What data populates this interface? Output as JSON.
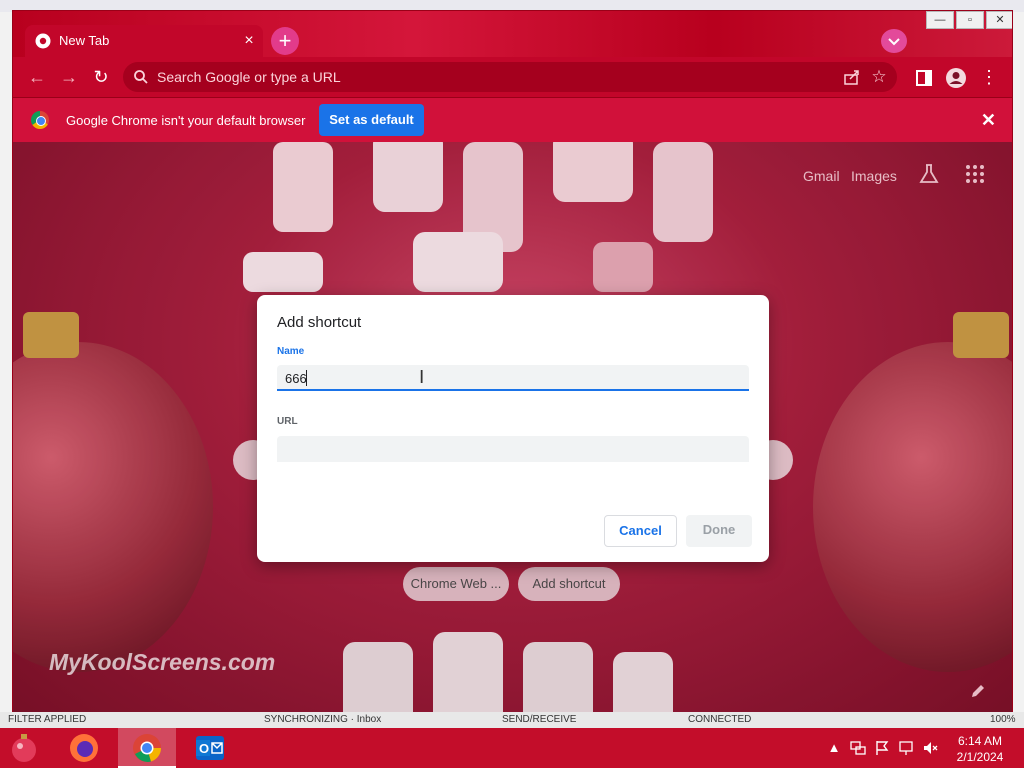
{
  "window": {
    "tab_title": "New Tab",
    "tab_close": "×",
    "new_tab": "+",
    "minimize": "—",
    "maximize": "▫",
    "close": "✕"
  },
  "toolbar": {
    "back": "←",
    "forward": "→",
    "reload": "↻",
    "omnibox_placeholder": "Search Google or type a URL",
    "bookmark_star": "☆",
    "menu": "⋮"
  },
  "infobar": {
    "message": "Google Chrome isn't your default browser",
    "set_default_label": "Set as default",
    "close": "✕"
  },
  "ntp": {
    "gmail": "Gmail",
    "images": "Images",
    "shortcuts": [
      "Chrome Web ...",
      "Add shortcut"
    ],
    "watermark": "MyKoolScreens.com"
  },
  "dialog": {
    "title": "Add shortcut",
    "name_label": "Name",
    "name_value": "666",
    "url_label": "URL",
    "url_value": "",
    "cancel_label": "Cancel",
    "done_label": "Done"
  },
  "statusbar": {
    "filter": "FILTER APPLIED",
    "sync": "SYNCHRONIZING · Inbox",
    "sendrecv": "SEND/RECEIVE",
    "connected": "CONNECTED",
    "zoom": "100%"
  },
  "taskbar": {
    "time": "6:14 AM",
    "date": "2/1/2024"
  },
  "colors": {
    "accent": "#1a73e8",
    "chrome_frame": "#c2062a",
    "infobar": "#d1113a",
    "taskbar": "#c30d2a"
  }
}
